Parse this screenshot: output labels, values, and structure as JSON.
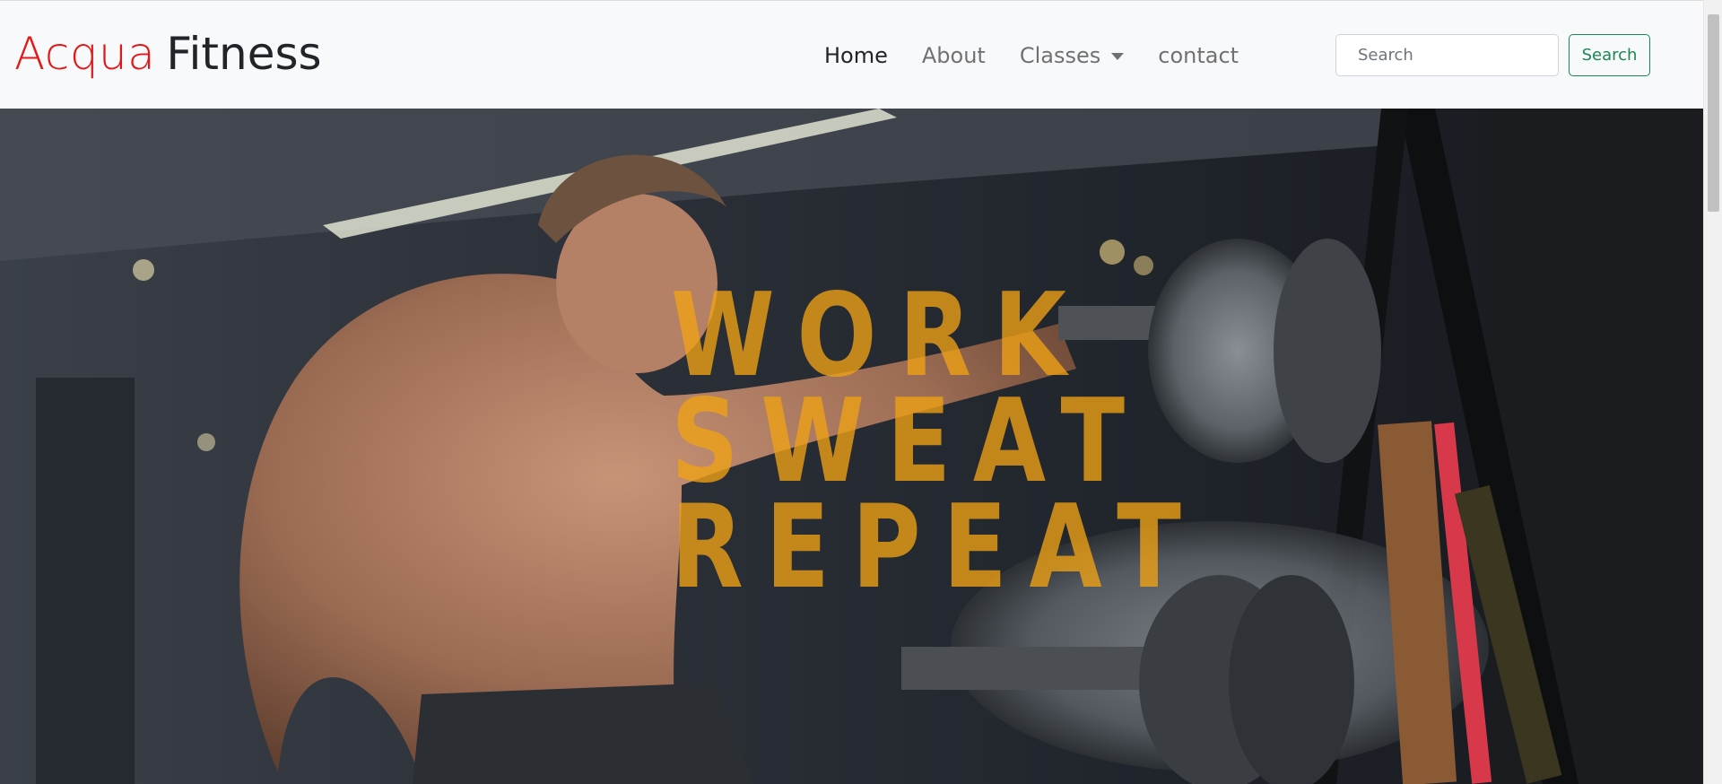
{
  "brand": {
    "part1": "Acqua",
    "part2": "Fitness",
    "part1_color": "#e51616",
    "part2_color": "#212529"
  },
  "nav": {
    "home": "Home",
    "about": "About",
    "classes": "Classes",
    "contact": "contact",
    "active": "Home"
  },
  "search": {
    "placeholder": "Search",
    "button_label": "Search",
    "button_color": "#198754"
  },
  "hero": {
    "line1": "WORK",
    "line2": "SWEAT",
    "line3": "REPEAT",
    "text_color": "#f0a214",
    "image_icon": "gym-athlete-photo"
  }
}
